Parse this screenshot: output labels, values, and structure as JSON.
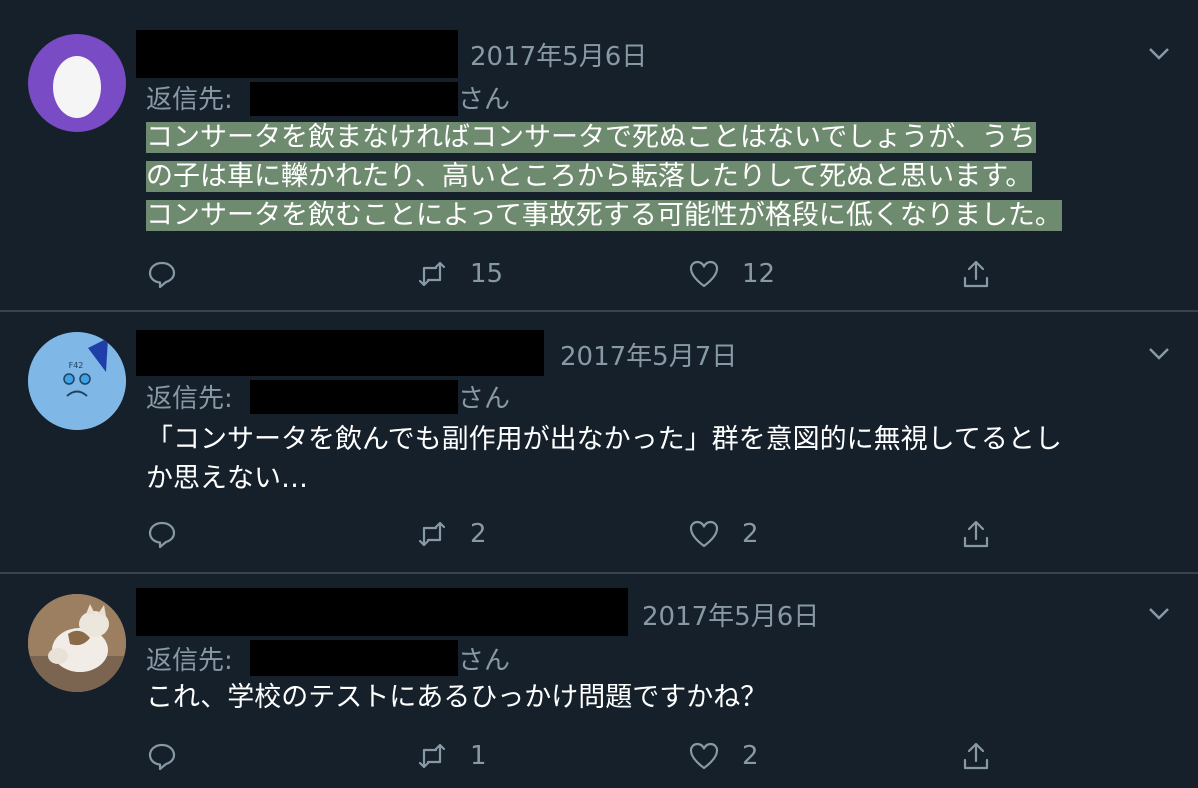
{
  "tweets": [
    {
      "date": "2017年5月6日",
      "reply_prefix": "返信先:",
      "reply_suffix": "さん",
      "body_lines": [
        "コンサータを飲まなければコンサータで死ぬことはないでしょうが、うち",
        "の子は車に轢かれたり、高いところから転落したりして死ぬと思います。",
        "コンサータを飲むことによって事故死する可能性が格段に低くなりました。"
      ],
      "reply_count": "",
      "retweet_count": "15",
      "like_count": "12",
      "avatar": "egg-avatar"
    },
    {
      "date": "2017年5月7日",
      "reply_prefix": "返信先:",
      "reply_suffix": "さん",
      "body_lines": [
        "「コンサータを飲んでも副作用が出なかった」群を意図的に無視してるとし",
        "か思えない…"
      ],
      "reply_count": "",
      "retweet_count": "2",
      "like_count": "2",
      "avatar": "f42-face-avatar"
    },
    {
      "date": "2017年5月6日",
      "reply_prefix": "返信先:",
      "reply_suffix": "さん",
      "body_lines": [
        "これ、学校のテストにあるひっかけ問題ですかね？"
      ],
      "reply_count": "",
      "retweet_count": "1",
      "like_count": "2",
      "avatar": "cat-photo-avatar"
    }
  ],
  "colors": {
    "background": "#15202b",
    "divider": "#38444d",
    "secondary_text": "#8899a6",
    "highlight": "#6e8a6f",
    "egg_avatar": "#794bc4",
    "f42_avatar": "#7fb7e6"
  },
  "avatar_text": {
    "f42": "F42"
  }
}
